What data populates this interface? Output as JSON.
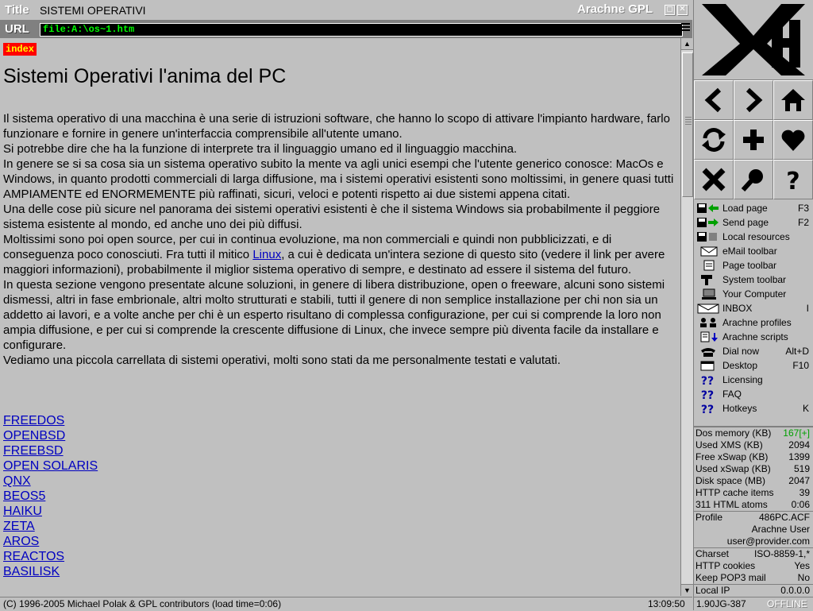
{
  "window": {
    "title_tag": "Title",
    "title": "SISTEMI OPERATIVI",
    "brand": "Arachne GPL",
    "max_glyph": "◻",
    "close_glyph": "✕"
  },
  "urlbar": {
    "tag": "URL",
    "value": "file:A:\\os~1.htm"
  },
  "page": {
    "index_label": "index",
    "heading": "Sistemi Operativi l'anima del PC",
    "paragraphs": [
      "Il sistema operativo di una macchina è una serie di istruzioni software, che hanno lo scopo di attivare l'impianto hardware, farlo funzionare e fornire in genere un'interfaccia comprensibile all'utente umano.",
      "Si potrebbe dire che ha la funzione di interprete tra il linguaggio umano ed il linguaggio macchina.",
      "In genere se si sa cosa sia un sistema operativo subito la mente va agli unici esempi che l'utente generico conosce: MacOs e Windows, in quanto prodotti commerciali di larga diffusione, ma i sistemi operativi esistenti sono moltissimi, in genere quasi tutti AMPIAMENTE ed ENORMEMENTE più raffinati, sicuri, veloci e potenti rispetto ai due sistemi appena citati.",
      "Una delle cose più sicure nel panorama dei sistemi operativi esistenti è che il sistema Windows sia probabilmente il peggiore sistema esistente al mondo, ed anche uno dei più diffusi."
    ],
    "p5_before": "Moltissimi sono poi open source, per cui in continua evoluzione, ma non commerciali e quindi non pubblicizzati, e di conseguenza poco conosciuti. Fra tutti il mitico ",
    "p5_link": "Linux",
    "p5_after": ", a cui è dedicata un'intera sezione di questo sito (vedere il link per avere maggiori informazioni), probabilmente il miglior sistema operativo di sempre, e destinato ad essere il sistema del futuro.",
    "p6": "In questa sezione vengono presentate alcune soluzioni, in genere di libera distribuzione, open o freeware, alcuni sono sistemi dismessi, altri in fase embrionale, altri molto strutturati e stabili, tutti il genere di non semplice installazione per chi non sia un addetto ai lavori, e a volte anche per chi è un esperto risultano di complessa configurazione, per cui si comprende la loro non ampia diffusione, e per cui si comprende la crescente diffusione di Linux, che invece sempre più diventa facile da installare e configurare.",
    "p7": "Vediamo una piccola carrellata di sistemi operativi, molti sono stati da me personalmente testati e valutati.",
    "links": [
      "FREEDOS",
      "OPENBSD",
      "FREEBSD",
      "OPEN SOLARIS",
      "QNX",
      "BEOS5",
      "HAIKU",
      "ZETA",
      "AROS",
      "REACTOS",
      "BASILISK"
    ]
  },
  "statusbar": {
    "text": "(C) 1996-2005 Michael Polak & GPL contributors (load time=0:06)",
    "time": "13:09:50"
  },
  "menu": [
    {
      "label": "Load page",
      "key": "F3",
      "icon": "floppy-load-icon"
    },
    {
      "label": "Send page",
      "key": "F2",
      "icon": "floppy-send-icon"
    },
    {
      "label": "Local resources",
      "key": "",
      "icon": "floppy-icon"
    },
    {
      "label": "eMail toolbar",
      "key": "",
      "icon": "envelope-icon"
    },
    {
      "label": "Page toolbar",
      "key": "",
      "icon": "page-icon"
    },
    {
      "label": "System toolbar",
      "key": "",
      "icon": "hammer-icon"
    },
    {
      "label": "Your Computer",
      "key": "",
      "icon": "computer-icon"
    },
    {
      "label": "INBOX",
      "key": "I",
      "icon": "inbox-icon"
    },
    {
      "label": "Arachne profiles",
      "key": "",
      "icon": "profiles-icon"
    },
    {
      "label": "Arachne scripts",
      "key": "",
      "icon": "scripts-icon"
    },
    {
      "label": "Dial now",
      "key": "Alt+D",
      "icon": "phone-icon"
    },
    {
      "label": "Desktop",
      "key": "F10",
      "icon": "desktop-icon"
    },
    {
      "label": "Licensing",
      "key": "",
      "icon": "question-icon"
    },
    {
      "label": "FAQ",
      "key": "",
      "icon": "question-icon"
    },
    {
      "label": "Hotkeys",
      "key": "K",
      "icon": "question-icon"
    }
  ],
  "stats": [
    {
      "label": "Dos memory (KB)",
      "value": "167[+]",
      "color": "#00a000"
    },
    {
      "label": "Used XMS (KB)",
      "value": "2094"
    },
    {
      "label": "Free xSwap (KB)",
      "value": "1399"
    },
    {
      "label": "Used xSwap (KB)",
      "value": "519"
    },
    {
      "label": "Disk space (MB)",
      "value": "2047"
    },
    {
      "label": "HTTP cache items",
      "value": "39"
    },
    {
      "label": "311 HTML atoms",
      "value": "0:06"
    }
  ],
  "profile": {
    "label": "Profile",
    "file": "486PC.ACF",
    "user": "Arachne User",
    "email": "user@provider.com"
  },
  "settings": [
    {
      "label": "Charset",
      "value": "ISO-8859-1,*"
    },
    {
      "label": "HTTP cookies",
      "value": "Yes"
    },
    {
      "label": "Keep POP3 mail",
      "value": "No"
    }
  ],
  "local_ip": {
    "label": "Local IP",
    "value": "0.0.0.0"
  },
  "panel_status": {
    "version": "1.90JG-387",
    "mode": "OFFLINE"
  }
}
